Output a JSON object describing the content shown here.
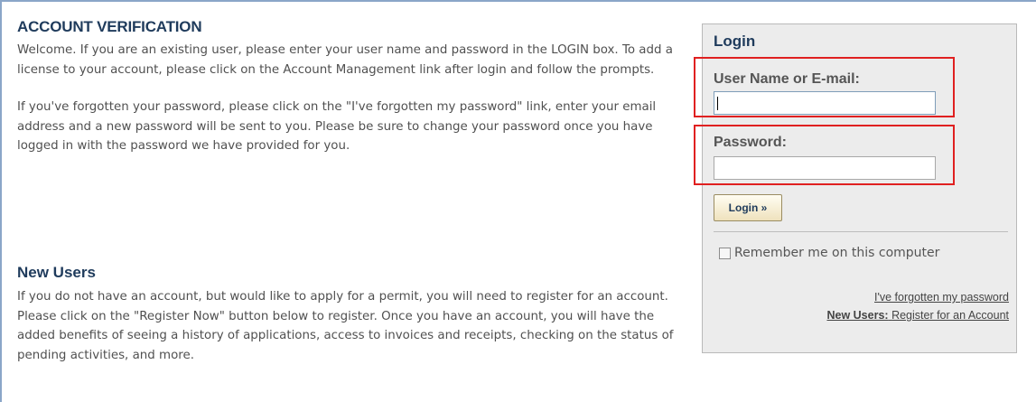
{
  "main": {
    "heading": "ACCOUNT VERIFICATION",
    "paragraph1": "Welcome. If you are an existing user, please enter your user name and password in the LOGIN box. To add a license to your account, please click on the Account Management link after login and follow the prompts.",
    "paragraph2": "If you've forgotten your password, please click on the \"I've forgotten my password\" link, enter your email address and a new password will be sent to you. Please be sure to change your password once you have logged in with the password we have provided for you.",
    "new_users_heading": "New Users",
    "paragraph3": "If you do not have an account, but would like to apply for a permit, you will need to register for an account. Please click on the \"Register Now\" button below to register. Once you have an account, you will have the added benefits of seeing a history of applications, access to invoices and receipts, checking on the status of pending activities, and more."
  },
  "login": {
    "title": "Login",
    "username_label": "User Name or E-mail:",
    "username_value": "",
    "password_label": "Password:",
    "password_value": "",
    "button_label": "Login »",
    "remember_label": "Remember me on this computer",
    "remember_checked": false,
    "forgot_link": "I've forgotten my password",
    "register_prefix": "New Users:",
    "register_link": "Register for an Account"
  },
  "colors": {
    "heading": "#1f3b5c",
    "highlight": "#e02020",
    "panel": "#ececec"
  }
}
